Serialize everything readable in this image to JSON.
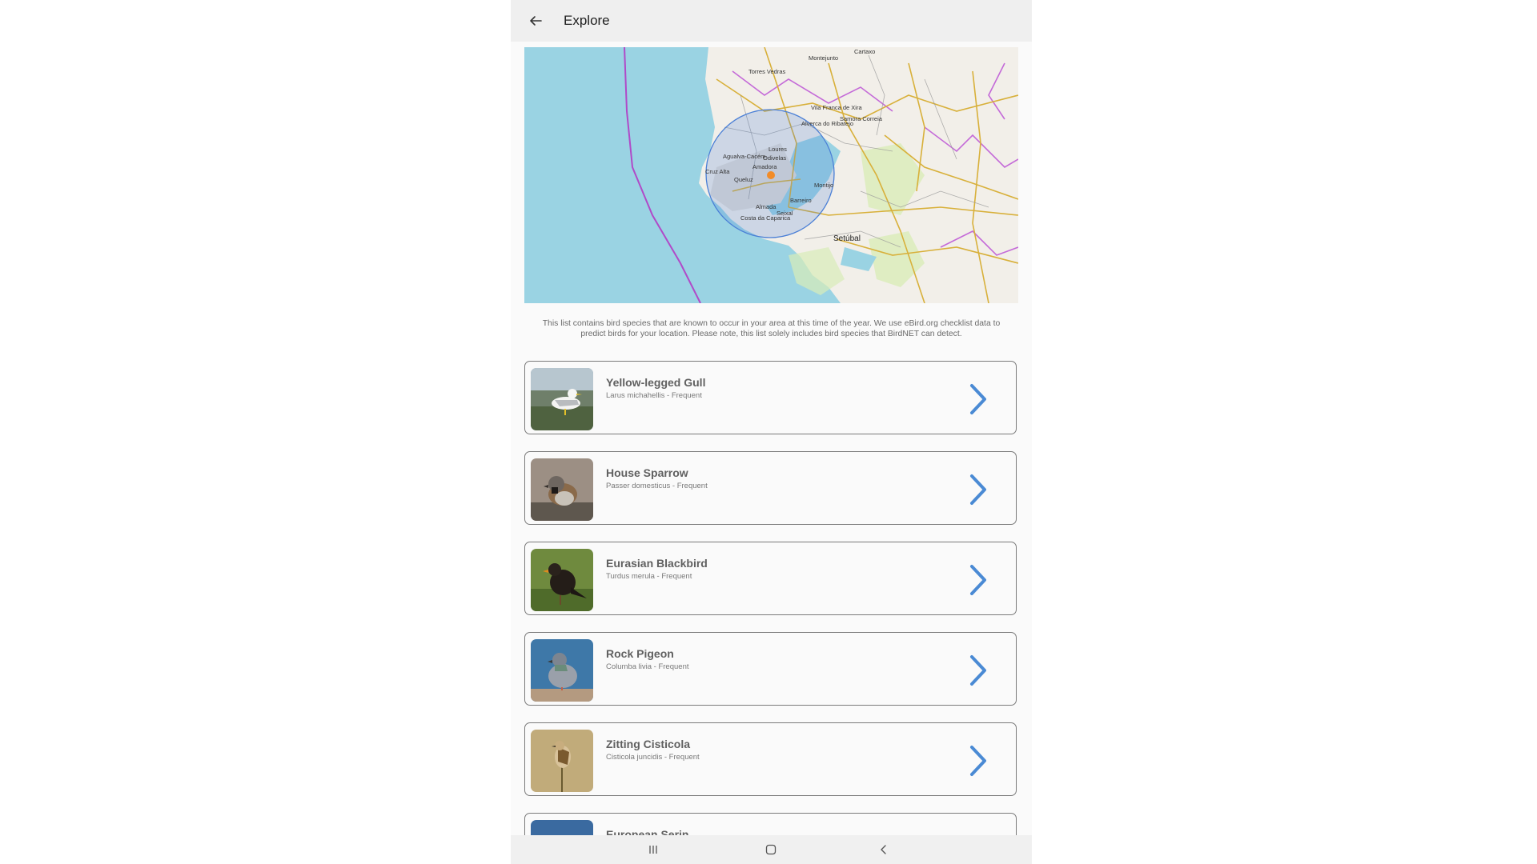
{
  "header": {
    "title": "Explore",
    "back_icon": "arrow-back-icon"
  },
  "map": {
    "labels": {
      "cartaxo": "Cartaxo",
      "montejunto": "Montejunto",
      "torres_vedras": "Torres Vedras",
      "vila_franca": "Vila Franca de Xira",
      "samora_correia": "Samora Correia",
      "alverca": "Alverca do Ribatejo",
      "loures": "Loures",
      "odivelas": "Odivelas",
      "agualva": "Agualva-Cacém",
      "amadora": "Amadora",
      "queluz": "Queluz",
      "cruz_alta": "Cruz Alta",
      "montijo": "Montijo",
      "barreiro": "Barreiro",
      "almada": "Almada",
      "costa_caparica": "Costa da Caparica",
      "seixal": "Seixal",
      "setubal": "Setúbal"
    },
    "colors": {
      "sea": "#9ad3e3",
      "land": "#f2efe9",
      "radius": "#4a7fd6",
      "location": "#f28c28"
    }
  },
  "description": "This list contains bird species that are known to occur in your area at this time of the year. We use eBird.org checklist data to predict birds for your location. Please note, this list solely includes bird species that BirdNET can detect.",
  "species": [
    {
      "name": "Yellow-legged Gull",
      "subtitle": "Larus michahellis - Frequent",
      "thumb_icon": "gull-photo"
    },
    {
      "name": "House Sparrow",
      "subtitle": "Passer domesticus - Frequent",
      "thumb_icon": "sparrow-photo"
    },
    {
      "name": "Eurasian Blackbird",
      "subtitle": "Turdus merula - Frequent",
      "thumb_icon": "blackbird-photo"
    },
    {
      "name": "Rock Pigeon",
      "subtitle": "Columba livia - Frequent",
      "thumb_icon": "pigeon-photo"
    },
    {
      "name": "Zitting Cisticola",
      "subtitle": "Cisticola juncidis - Frequent",
      "thumb_icon": "cisticola-photo"
    },
    {
      "name": "European Serin",
      "subtitle": "",
      "thumb_icon": "serin-photo"
    }
  ],
  "nav": {
    "recents_icon": "recents-icon",
    "home_icon": "home-icon",
    "back_icon": "nav-back-icon"
  },
  "accent_color": "#4a8ad4"
}
